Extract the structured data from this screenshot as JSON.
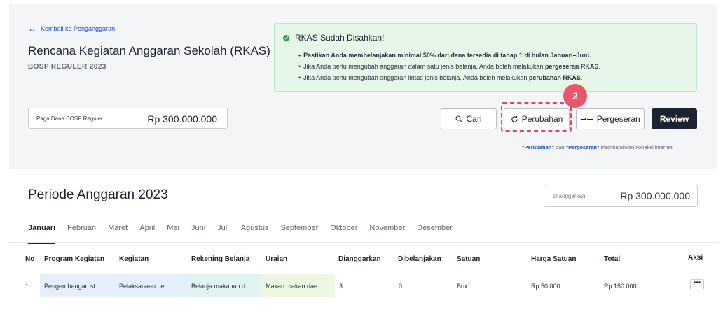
{
  "header": {
    "back_link": "Kembali ke Penganggaran",
    "title": "Rencana Kegiatan Anggaran Sekolah (RKAS)",
    "subtitle": "BOSP REGULER 2023"
  },
  "alert": {
    "title": "RKAS Sudah Disahkan!",
    "items": [
      "Pastikan Anda membelanjakan minimal 50% dari dana tersedia di tahap 1 di bulan Januari–Juni.",
      "Jika Anda perlu mengubah anggaran dalam satu jenis belanja, Anda boleh melakukan pergeseran RKAS.",
      "Jika Anda perlu mengubah anggaran lintas jenis belanja, Anda boleh melakukan perubahan RKAS."
    ]
  },
  "pagu": {
    "label": "Pagu Dana BOSP Reguler",
    "value": "Rp 300.000.000"
  },
  "toolbar": {
    "cari": "Cari",
    "perubahan": "Perubahan",
    "pergeseran": "Pergeseran",
    "review": "Review"
  },
  "step_badge": "2",
  "connection_note": {
    "perubahan": "\"Perubahan\"",
    "dan": " dan ",
    "pergeseran": "\"Pergeseran\"",
    "rest": " membutuhkan koneksi internet"
  },
  "periode": {
    "title": "Periode Anggaran 2023",
    "budget_label": "Dianggarkan",
    "budget_value": "Rp 300.000.000"
  },
  "months": [
    "Januari",
    "Februari",
    "Maret",
    "April",
    "Mei",
    "Juni",
    "Juli",
    "Agustus",
    "September",
    "Oktober",
    "November",
    "Desember"
  ],
  "table": {
    "headers": {
      "no": "No",
      "program": "Program Kegiatan",
      "kegiatan": "Kegiatan",
      "rekening": "Rekening Belanja",
      "uraian": "Uraian",
      "dianggarkan": "Dianggarkan",
      "dibelanjakan": "Dibelanjakan",
      "satuan": "Satuan",
      "harga": "Harga Satuan",
      "total": "Total",
      "aksi": "Aksi"
    },
    "rows": [
      {
        "no": "1",
        "program": "Pengembangan st...",
        "kegiatan": "Pelaksanaan pen...",
        "rekening": "Belanja makanan d...",
        "uraian": "Makan makan dae...",
        "dianggarkan": "3",
        "dibelanjakan": "0",
        "satuan": "Box",
        "harga": "Rp 50.000",
        "total": "Rp 150.000",
        "aksi": "•••"
      }
    ]
  }
}
